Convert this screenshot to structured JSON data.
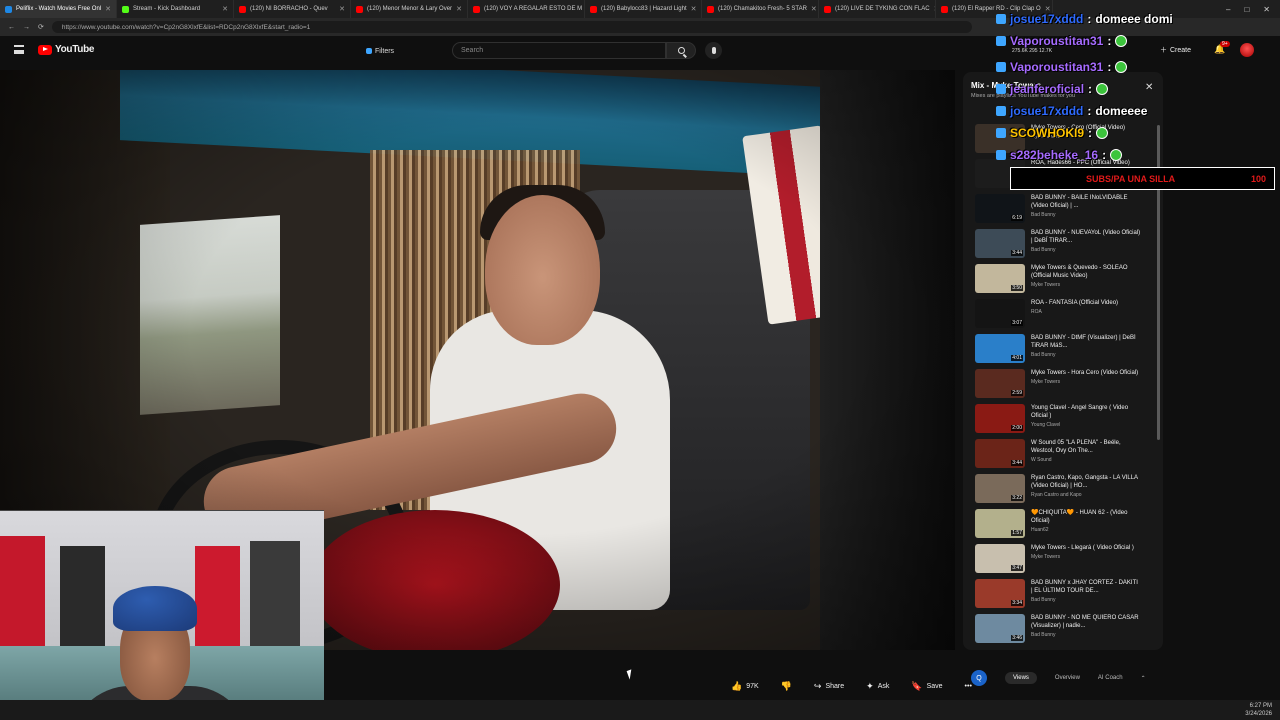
{
  "browser": {
    "tabs": [
      {
        "title": "Peliflix - Watch Movies Free Onl",
        "color": "#1e88e5"
      },
      {
        "title": "Stream - Kick Dashboard",
        "color": "#53fc18"
      },
      {
        "title": "(120) NI BORRACHO - Quev",
        "color": "#ff0000"
      },
      {
        "title": "(120) Menor Menor & Lary Over",
        "color": "#ff0000"
      },
      {
        "title": "(120) VOY A REGALAR ESTO DE M",
        "color": "#ff0000"
      },
      {
        "title": "(120) Babylocc83 | Hazard Light",
        "color": "#ff0000"
      },
      {
        "title": "(120) Chamakitoo Fresh- 5 STAR",
        "color": "#ff0000"
      },
      {
        "title": "(120) LIVE DE TYKING CON FLAC",
        "color": "#ff0000"
      },
      {
        "title": "(120) El Rapper RD - Clip Clap O",
        "color": "#ff0000"
      }
    ],
    "url": "https://www.youtube.com/watch?v=Cp2nG8XlxfE&list=RDCp2nG8XlxfE&start_radio=1"
  },
  "youtube": {
    "logo_text": "YouTube",
    "filters_label": "Filters",
    "search_placeholder": "Search",
    "create_label": "Create",
    "bell_badge": "9+"
  },
  "actions": {
    "likes": "97K",
    "share": "Share",
    "ask": "Ask",
    "save": "Save",
    "more": "•••"
  },
  "playlist": {
    "title": "Mix - Myke Towers",
    "subtitle": "Mixes are playlists YouTube makes for you",
    "items": [
      {
        "title": "Myke Towers - Cero (Official Video)",
        "channel": "Myke Towers",
        "duration": "",
        "color": "#3a3028"
      },
      {
        "title": "ROA, Hades66 - PPC (Official Video)",
        "channel": "ROA",
        "duration": "4:01",
        "color": "#1c1c1c"
      },
      {
        "title": "BAD BUNNY - BAILE INoLVIDABLE (Video Oficial) | ...",
        "channel": "Bad Bunny",
        "duration": "6:19",
        "color": "#101418"
      },
      {
        "title": "BAD BUNNY - NUEVAYoL (Video Oficial) | DeBÍ TIRAR...",
        "channel": "Bad Bunny",
        "duration": "3:44",
        "color": "#3d4b57"
      },
      {
        "title": "Myke Towers & Quevedo - SOLEAO (Official Music Video)",
        "channel": "Myke Towers",
        "duration": "3:50",
        "color": "#c2b79c"
      },
      {
        "title": "ROA - FANTASÍA (Official Video)",
        "channel": "ROA",
        "duration": "3:07",
        "color": "#141414"
      },
      {
        "title": "BAD BUNNY - DtMF (Visualizer) | DeBÍ TiRAR MáS...",
        "channel": "Bad Bunny",
        "duration": "4:01",
        "color": "#2a7fc9"
      },
      {
        "title": "Myke Towers - Hora Cero (Video Oficial)",
        "channel": "Myke Towers",
        "duration": "2:59",
        "color": "#5a2a1f"
      },
      {
        "title": "Young Clavel - Angel Sangre ( Video Oficial )",
        "channel": "Young Clavel",
        "duration": "2:00",
        "color": "#8a1a14"
      },
      {
        "title": "W Sound 05 \"LA PLENA\" - Beéle, Westcol, Ovy On The...",
        "channel": "W Sound",
        "duration": "3:44",
        "color": "#6b2418"
      },
      {
        "title": "Ryan Castro, Kapo, Gangsta - LA VILLA (Video Oficial) | HO...",
        "channel": "Ryan Castro and Kapo",
        "duration": "3:22",
        "color": "#7a6a5a"
      },
      {
        "title": "🧡CHIQUITA🧡 - HUAN 62 - (Video Oficial)",
        "channel": "Huan62",
        "duration": "1:57",
        "color": "#b3b08c"
      },
      {
        "title": "Myke Towers - Llegará ( Video Oficial )",
        "channel": "Myke Towers",
        "duration": "3:47",
        "color": "#c8bfae"
      },
      {
        "title": "BAD BUNNY x JHAY CORTEZ - DÁKITI | EL ÚLTIMO TOUR DE...",
        "channel": "Bad Bunny",
        "duration": "3:34",
        "color": "#9a3a2a"
      },
      {
        "title": "BAD BUNNY - NO ME QUIERO CASAR (Visualizer) | nadie...",
        "channel": "Bad Bunny",
        "duration": "3:46",
        "color": "#6e8aa0"
      }
    ]
  },
  "panel_footer": {
    "icon": "Q",
    "tabs": [
      "Views",
      "Overview",
      "AI Coach"
    ]
  },
  "chat": [
    {
      "user": "josue17xddd",
      "message": "domeee domi",
      "color": "blue"
    },
    {
      "user": "Vaporoustitan31",
      "message": "",
      "color": "purple"
    },
    {
      "user": "Vaporoustitan31",
      "message": "",
      "color": "purple"
    },
    {
      "user": "jeanferoficial",
      "message": "",
      "color": "purple"
    },
    {
      "user": "josue17xddd",
      "message": "domeeee",
      "color": "blue"
    },
    {
      "user": "SCOWHOKI9",
      "message": "",
      "color": "gold"
    },
    {
      "user": "s282beheke_16",
      "message": "",
      "color": "purple"
    }
  ],
  "chat_stats": "275.6K  295  12.7K",
  "goal": {
    "label": "SUBS/PA UNA SILLA",
    "value": "100"
  },
  "taskbar": {
    "time": "6:27 PM",
    "date": "3/24/2026"
  }
}
